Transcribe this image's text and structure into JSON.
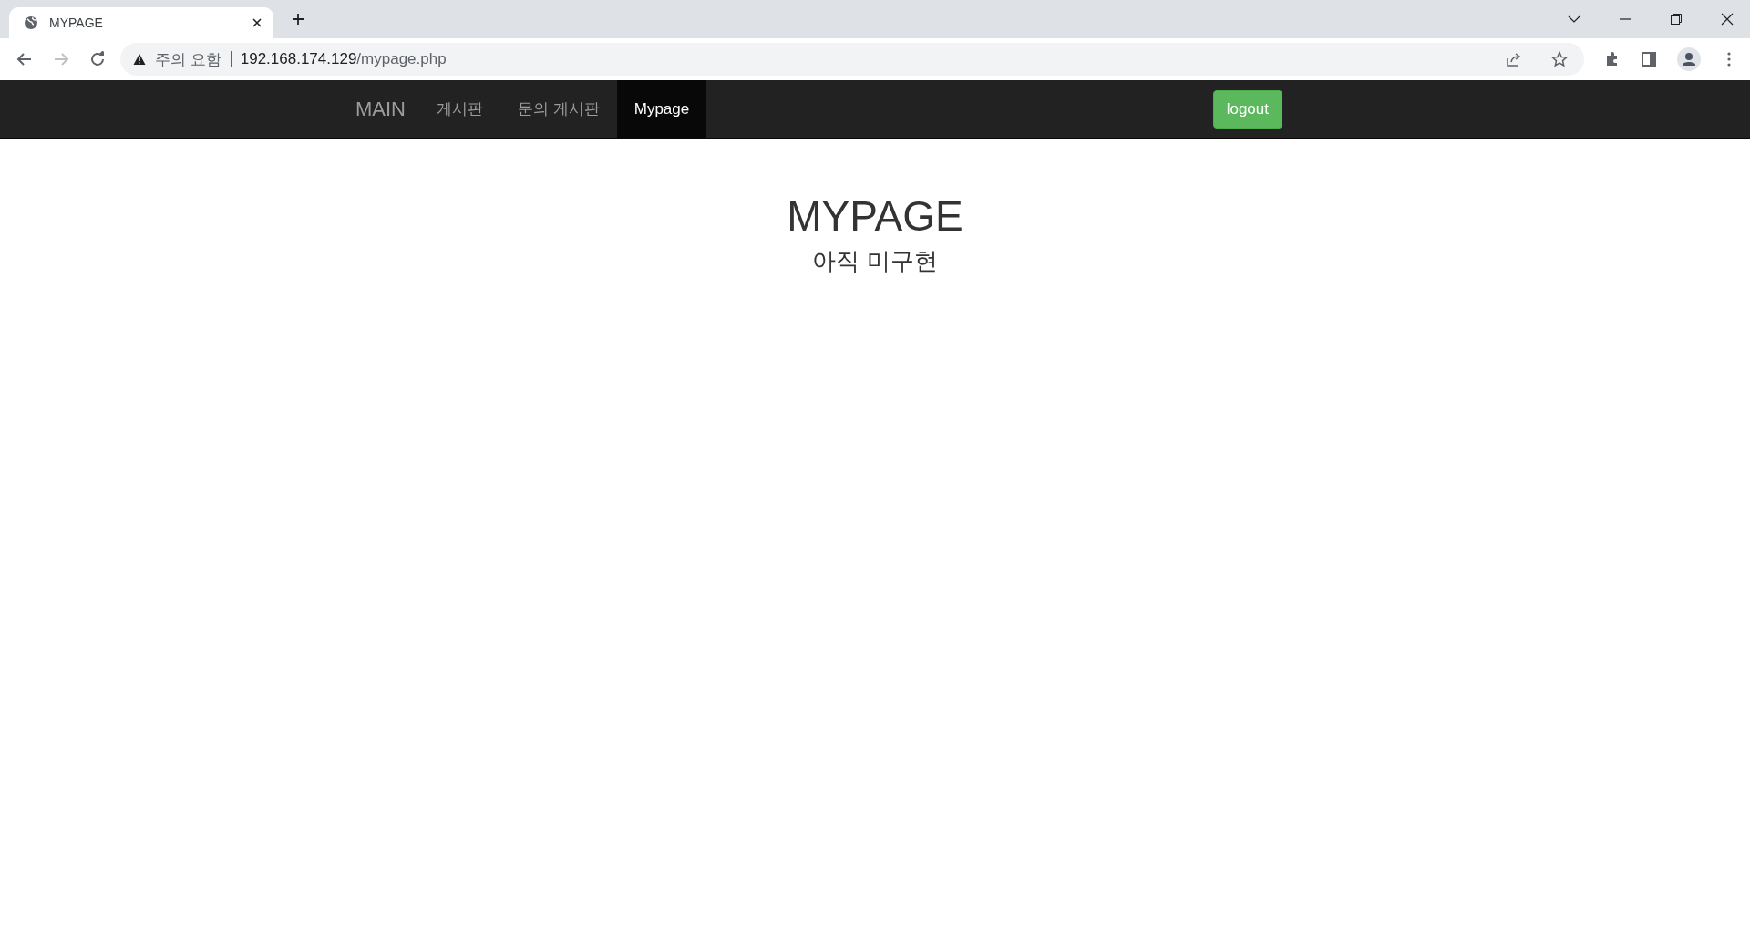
{
  "browser": {
    "tab": {
      "title": "MYPAGE"
    },
    "address": {
      "warning": "주의 요함",
      "host": "192.168.174.129",
      "path": "/mypage.php"
    }
  },
  "navbar": {
    "brand": "MAIN",
    "items": [
      {
        "label": "게시판",
        "selected": false
      },
      {
        "label": "문의 게시판",
        "selected": false
      },
      {
        "label": "Mypage",
        "selected": true
      }
    ],
    "logout": "logout"
  },
  "content": {
    "heading": "MYPAGE",
    "subheading": "아직 미구현"
  }
}
